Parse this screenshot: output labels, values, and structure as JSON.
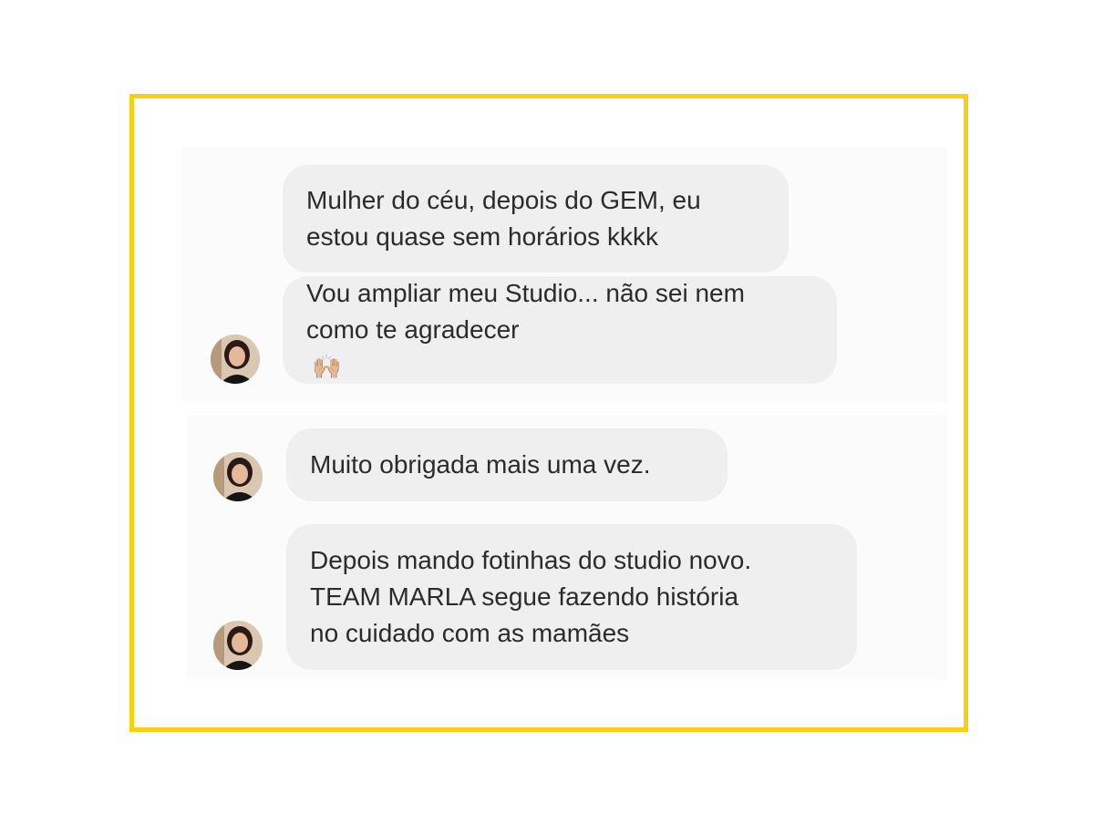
{
  "messages": [
    {
      "text": "Mulher do céu, depois do GEM, eu\nestou quase sem horários kkkk"
    },
    {
      "text": "Vou ampliar meu Studio... não sei nem\ncomo te agradecer",
      "emoji": "🙌🏼"
    },
    {
      "text": "Muito obrigada mais uma vez."
    },
    {
      "text": "Depois mando fotinhas do studio novo.\nTEAM MARLA segue fazendo história\nno cuidado com as mamães"
    }
  ],
  "colors": {
    "frame_border": "#f8d012",
    "bubble_background": "#efefef",
    "text": "#2b2b2b"
  }
}
